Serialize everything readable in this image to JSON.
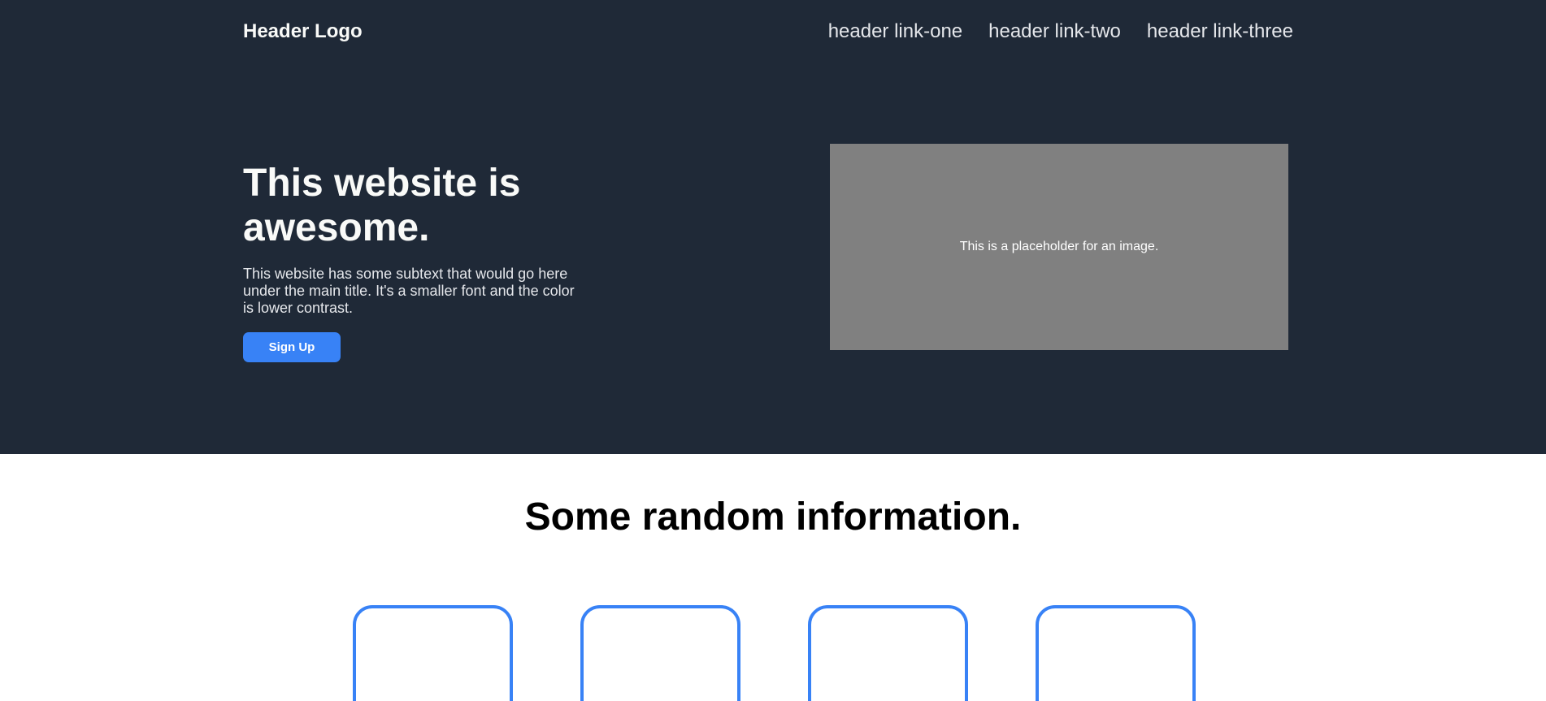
{
  "header": {
    "logo": "Header Logo",
    "links": [
      "header link-one",
      "header link-two",
      "header link-three"
    ]
  },
  "hero": {
    "title": "This website is awesome.",
    "subtext": "This website has some subtext that would go here under the main title. It's a smaller font and the color is lower contrast.",
    "signup_label": "Sign Up",
    "image_placeholder_text": "This is a placeholder for an image."
  },
  "info": {
    "title": "Some random information.",
    "card_count": 4
  },
  "colors": {
    "hero_background": "#1f2937",
    "accent": "#3882f6",
    "placeholder_gray": "#808080"
  }
}
